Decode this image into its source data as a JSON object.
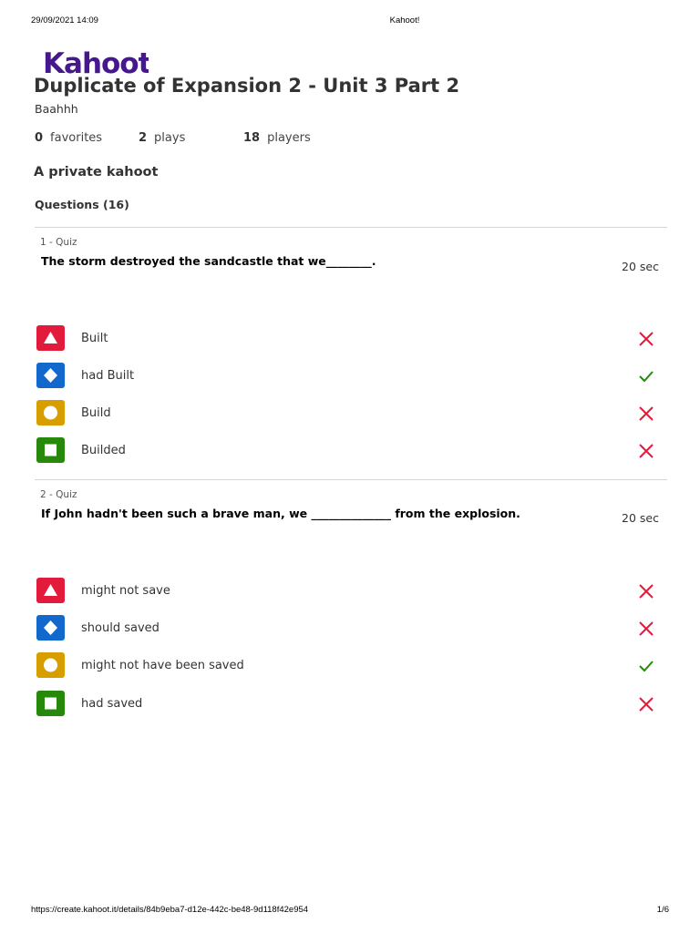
{
  "print_header": {
    "datetime": "29/09/2021 14:09",
    "title": "Kahoot!"
  },
  "print_footer": {
    "url": "https://create.kahoot.it/details/84b9eba7-d12e-442c-be48-9d118f42e954",
    "page": "1/6"
  },
  "logo": {
    "text": "Kahoot!",
    "color": "#46178f"
  },
  "kahoot": {
    "title": "Duplicate of Expansion 2 - Unit 3 Part 2",
    "creator": "Baahhh",
    "stats": [
      {
        "value": "0",
        "label": "favorites"
      },
      {
        "value": "2",
        "label": "plays"
      },
      {
        "value": "18",
        "label": "players"
      }
    ],
    "visibility": "A private kahoot",
    "questions_count": "Questions (16)"
  },
  "colors": {
    "red": "#e21b3c",
    "blue": "#1368ce",
    "yellow": "#d89e00",
    "green": "#26890c",
    "correct": "#26890c",
    "incorrect": "#e21b3c"
  },
  "questions": [
    {
      "type": "1 - Quiz",
      "text": "The storm destroyed the sandcastle that we________.",
      "time": "20 sec",
      "answers": [
        {
          "shape": "triangle-icon",
          "color": "red",
          "text": "Built",
          "correct": false
        },
        {
          "shape": "diamond-icon",
          "color": "blue",
          "text": "had Built",
          "correct": true
        },
        {
          "shape": "circle-icon",
          "color": "yellow",
          "text": "Build",
          "correct": false
        },
        {
          "shape": "square-icon",
          "color": "green",
          "text": "Builded",
          "correct": false
        }
      ]
    },
    {
      "type": "2 - Quiz",
      "text": "If John hadn't been such a brave man, we ______________ from the explosion.",
      "time": "20 sec",
      "answers": [
        {
          "shape": "triangle-icon",
          "color": "red",
          "text": "might not save",
          "correct": false
        },
        {
          "shape": "diamond-icon",
          "color": "blue",
          "text": "should saved",
          "correct": false
        },
        {
          "shape": "circle-icon",
          "color": "yellow",
          "text": "might not have been saved",
          "correct": true
        },
        {
          "shape": "square-icon",
          "color": "green",
          "text": "had saved",
          "correct": false
        }
      ]
    }
  ]
}
